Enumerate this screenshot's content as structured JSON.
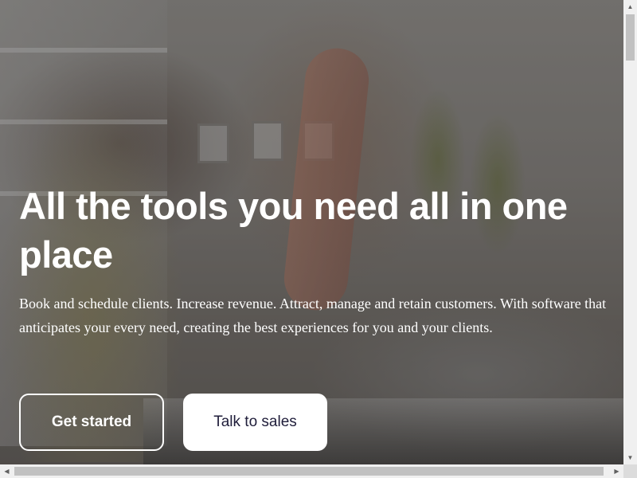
{
  "hero": {
    "headline": "All the tools you need all in one place",
    "subtext": "Book and schedule clients. Increase revenue. Attract, manage and retain customers. With software that anticipates your every need, creating the best experiences for you and your clients.",
    "primary_button": "Get started",
    "secondary_button": "Talk to sales",
    "image": "massage-therapy-photo"
  },
  "scrollbars": {
    "up_icon": "▲",
    "down_icon": "▼",
    "left_icon": "◀",
    "right_icon": "▶"
  },
  "colors": {
    "text": "#ffffff",
    "secondary_button_text": "#1f1d3a",
    "secondary_button_bg": "#ffffff"
  }
}
